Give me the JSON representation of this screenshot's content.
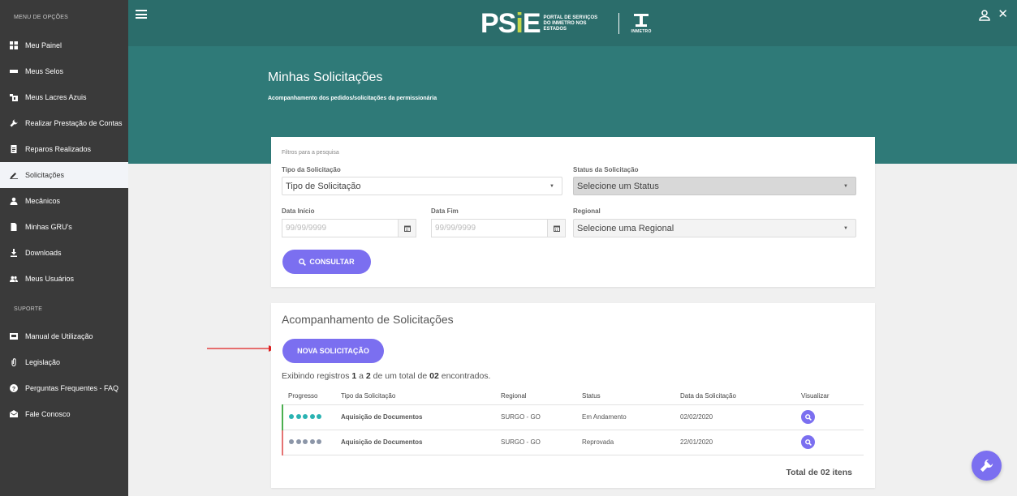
{
  "sidebar": {
    "menu_section": "MENU DE OPÇÕES",
    "items": [
      {
        "label": "Meu Painel",
        "icon": "dashboard-icon"
      },
      {
        "label": "Meus Selos",
        "icon": "seal-icon"
      },
      {
        "label": "Meus Lacres Azuis",
        "icon": "lock-seal-icon"
      },
      {
        "label": "Realizar Prestação de Contas",
        "icon": "wrench-icon"
      },
      {
        "label": "Reparos Realizados",
        "icon": "document-icon"
      },
      {
        "label": "Solicitações",
        "icon": "pencil-icon",
        "active": true
      },
      {
        "label": "Mecânicos",
        "icon": "person-icon"
      },
      {
        "label": "Minhas GRU's",
        "icon": "file-icon"
      },
      {
        "label": "Downloads",
        "icon": "download-icon"
      },
      {
        "label": "Meus Usuários",
        "icon": "users-icon"
      }
    ],
    "support_section": "SUPORTE",
    "support_items": [
      {
        "label": "Manual de Utilização",
        "icon": "book-icon"
      },
      {
        "label": "Legislação",
        "icon": "paperclip-icon"
      },
      {
        "label": "Perguntas Frequentes - FAQ",
        "icon": "question-icon"
      },
      {
        "label": "Fale Conosco",
        "icon": "mail-icon"
      }
    ]
  },
  "topbar": {
    "logo_main": "PS",
    "logo_accent": "i",
    "logo_end": "E",
    "logo_text_1": "PORTAL DE SERVIÇOS",
    "logo_text_2": "DO INMETRO NOS ESTADOS",
    "inmetro_label": "INMETRO"
  },
  "header": {
    "title": "Minhas Solicitações",
    "subtitle": "Acompanhamento dos pedidos/solicitações da permissionária"
  },
  "filters": {
    "hint": "Filtros para a pesquisa",
    "tipo_label": "Tipo da Solicitação",
    "tipo_value": "Tipo de Solicitação",
    "status_label": "Status da Solicitação",
    "status_value": "Selecione um Status",
    "data_inicio_label": "Data Início",
    "data_inicio_placeholder": "99/99/9999",
    "data_fim_label": "Data Fim",
    "data_fim_placeholder": "99/99/9999",
    "regional_label": "Regional",
    "regional_value": "Selecione uma Regional",
    "consultar_label": "CONSULTAR"
  },
  "results": {
    "title": "Acompanhamento de Solicitações",
    "new_button": "NOVA SOLICITAÇÃO",
    "info_prefix": "Exibindo registros ",
    "info_from": "1",
    "info_mid": " a ",
    "info_to": "2",
    "info_of": " de um total de ",
    "info_total": "02",
    "info_suffix": " encontrados.",
    "columns": [
      "Progresso",
      "Tipo da Solicitação",
      "Regional",
      "Status",
      "Data da Solicitação",
      "Visualizar"
    ],
    "rows": [
      {
        "progress": 5,
        "tipo": "Aquisição de Documentos",
        "regional": "SURGO - GO",
        "status": "Em Andamento",
        "data": "02/02/2020",
        "bar_color": "#4caf50"
      },
      {
        "progress": 0,
        "tipo": "Aquisição de Documentos",
        "regional": "SURGO - GO",
        "status": "Reprovada",
        "data": "22/01/2020",
        "bar_color": "#e57373"
      }
    ],
    "total": "Total de 02 itens"
  },
  "colors": {
    "accent": "#7b6ff0",
    "teal_header": "#2f7a78",
    "topbar": "#2b6d6b",
    "sidebar": "#3a3a3a",
    "progress_on": "#2ab3b2",
    "progress_off": "#8c96a8"
  }
}
